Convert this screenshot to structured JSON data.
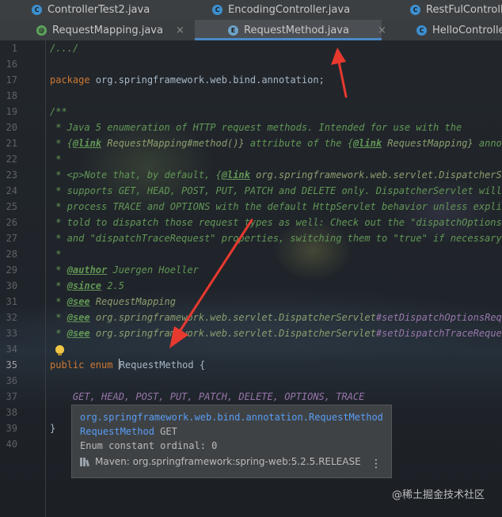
{
  "tabs_row1": [
    {
      "label": "ControllerTest2.java",
      "icon": "class-icon"
    },
    {
      "label": "EncodingController.java",
      "icon": "class-icon"
    },
    {
      "label": "RestFulController",
      "icon": "class-icon"
    }
  ],
  "tabs_row2": [
    {
      "label": "RequestMapping.java",
      "icon": "annotation-icon",
      "close": "×"
    },
    {
      "label": "RequestMethod.java",
      "icon": "enum-icon",
      "close": "×",
      "active": true
    },
    {
      "label": "HelloController.j",
      "icon": "class-icon"
    }
  ],
  "gutter": [
    "1",
    "16",
    "17",
    "18",
    "19",
    "20",
    "21",
    "22",
    "23",
    "24",
    "25",
    "26",
    "27",
    "28",
    "29",
    "30",
    "31",
    "32",
    "33",
    "34",
    "35",
    "36",
    "37",
    "38",
    "39",
    "40"
  ],
  "code": {
    "l1": "/.../",
    "l17_kw": "package",
    "l17_rest": " org.springframework.web.bind.annotation;",
    "l19": "/**",
    "l20": " * Java 5 enumeration of HTTP request methods. Intended for use with the",
    "l21_a": " * {",
    "l21_tag": "@link",
    "l21_ref": " RequestMapping#method()}",
    "l21_b": " attribute of the {",
    "l21_tag2": "@link",
    "l21_ref2": " RequestMapping}",
    "l21_c": " annotati",
    "l22": " *",
    "l23_a": " * <p>Note that, by default, {",
    "l23_tag": "@link",
    "l23_ref": " org.springframework.web.servlet.DispatcherServ",
    "l24": " * supports GET, HEAD, POST, PUT, PATCH and DELETE only. DispatcherServlet will",
    "l25": " * process TRACE and OPTIONS with the default HttpServlet behavior unless explicit",
    "l26": " * told to dispatch those request types as well: Check out the \"dispatchOptionsReq",
    "l27": " * and \"dispatchTraceRequest\" properties, switching them to \"true\" if necessary.",
    "l28": " *",
    "l29_a": " * ",
    "l29_tag": "@author",
    "l29_b": " Juergen Hoeller",
    "l30_a": " * ",
    "l30_tag": "@since",
    "l30_b": " 2.5",
    "l31_a": " * ",
    "l31_tag": "@see",
    "l31_ref": " RequestMapping",
    "l32_a": " * ",
    "l32_tag": "@see",
    "l32_ref": " org.springframework.web.servlet.DispatcherServlet",
    "l32_b": "#setDispatchOptionsReques",
    "l33_a": " * ",
    "l33_tag": "@see",
    "l33_ref": " org.springframework.web.servlet.DispatcherServlet",
    "l33_b": "#setDispatchTraceRequest",
    "l34": " */",
    "l35_kw": "public enum ",
    "l35_name": "RequestMethod",
    "l35_rest": " {",
    "l37": "    GET, HEAD, POST, PUT, PATCH, DELETE, OPTIONS, TRACE",
    "l39": "}"
  },
  "popup": {
    "package": "org.springframework.web.bind.annotation.RequestMethod",
    "type_link": "RequestMethod",
    "constant": " GET",
    "ordinal": "Enum constant ordinal: 0",
    "maven": "Maven: org.springframework:spring-web:5.2.5.RELEASE",
    "menu": "⋮"
  },
  "watermark": "@稀土掘金技术社区",
  "colors": {
    "keyword": "#cc7832",
    "comment": "#629755",
    "enum_constant": "#9876aa",
    "link": "#589df6",
    "arrow": "#e8392f"
  }
}
